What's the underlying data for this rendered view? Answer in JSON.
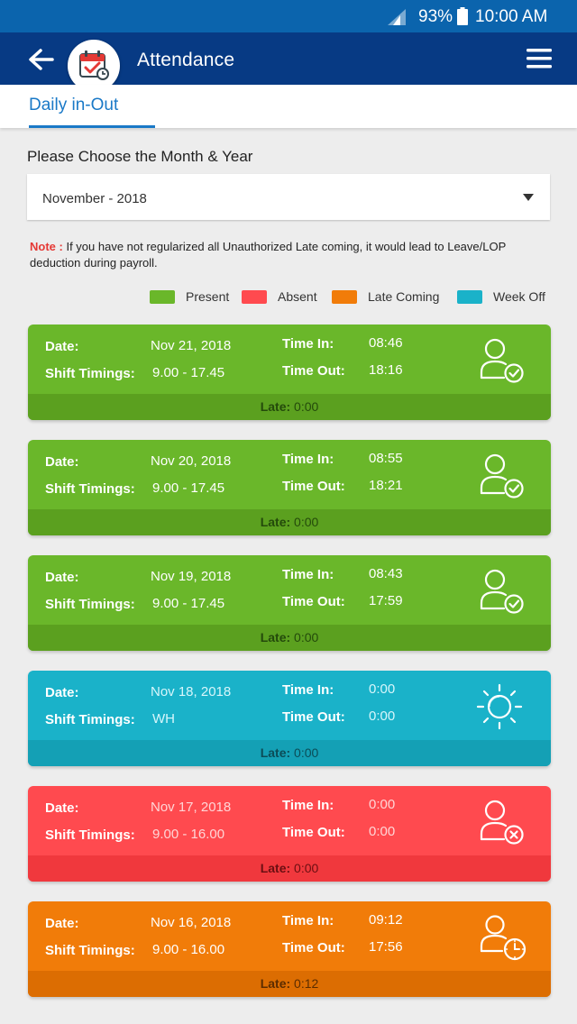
{
  "status_bar": {
    "battery": "93%",
    "time": "10:00 AM"
  },
  "header": {
    "title": "Attendance",
    "back_icon": "back-arrow-icon",
    "logo_icon": "calendar-check-icon",
    "menu_icon": "hamburger-menu-icon"
  },
  "tabs": [
    {
      "label": "Daily in-Out",
      "active": true
    }
  ],
  "filter": {
    "label": "Please Choose the Month & Year",
    "selected": "November - 2018"
  },
  "note": {
    "label": "Note :",
    "text": " If you have not regularized all Unauthorized Late coming, it would lead to Leave/LOP deduction during payroll."
  },
  "legend": [
    {
      "label": "Present",
      "color": "#6ab72a"
    },
    {
      "label": "Absent",
      "color": "#ff4a4f"
    },
    {
      "label": "Late Coming",
      "color": "#f17c09"
    },
    {
      "label": "Week Off",
      "color": "#1ab2c9"
    }
  ],
  "labels": {
    "date": "Date:",
    "shift": "Shift Timings:",
    "time_in": "Time In:",
    "time_out": "Time Out:",
    "late": "Late:"
  },
  "records": [
    {
      "status": "present",
      "icon": "user-check-icon",
      "date": "Nov 21, 2018",
      "shift": "9.00 - 17.45",
      "time_in": "08:46",
      "time_out": "18:16",
      "late": "0:00"
    },
    {
      "status": "present",
      "icon": "user-check-icon",
      "date": "Nov 20, 2018",
      "shift": "9.00 - 17.45",
      "time_in": "08:55",
      "time_out": "18:21",
      "late": "0:00"
    },
    {
      "status": "present",
      "icon": "user-check-icon",
      "date": "Nov 19, 2018",
      "shift": "9.00 - 17.45",
      "time_in": "08:43",
      "time_out": "17:59",
      "late": "0:00"
    },
    {
      "status": "weekoff",
      "icon": "sun-icon",
      "date": "Nov 18, 2018",
      "shift": "WH",
      "time_in": "0:00",
      "time_out": "0:00",
      "late": "0:00"
    },
    {
      "status": "absent",
      "icon": "user-cross-icon",
      "date": "Nov 17, 2018",
      "shift": "9.00 - 16.00",
      "time_in": "0:00",
      "time_out": "0:00",
      "late": "0:00"
    },
    {
      "status": "late",
      "icon": "user-clock-icon",
      "date": "Nov 16, 2018",
      "shift": "9.00 - 16.00",
      "time_in": "09:12",
      "time_out": "17:56",
      "late": "0:12"
    }
  ]
}
